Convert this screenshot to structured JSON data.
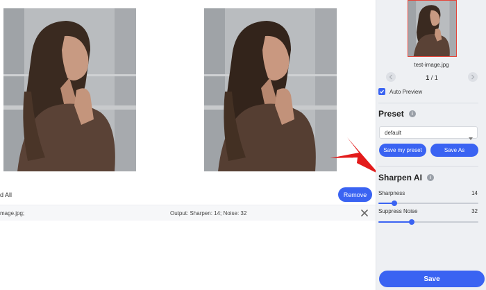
{
  "list": {
    "added_all": "d All",
    "remove_label": "Remove"
  },
  "file": {
    "name": "mage.jpg;",
    "output": "Output: Sharpen: 14; Noise: 32"
  },
  "sidebar": {
    "thumbnail_name": "test-image.jpg",
    "page_current": "1",
    "page_separator": " / ",
    "page_total": "1",
    "auto_preview_label": "Auto Preview",
    "auto_preview_checked": true,
    "preset": {
      "title": "Preset",
      "selected": "default",
      "save_my_preset_label": "Save my preset",
      "save_as_label": "Save As"
    },
    "sharpen": {
      "title": "Sharpen AI",
      "sharpness_label": "Sharpness",
      "sharpness_value": "14",
      "sharpness_fraction": 0.16,
      "noise_label": "Suppress Noise",
      "noise_value": "32",
      "noise_fraction": 0.33
    },
    "save_label": "Save"
  },
  "colors": {
    "accent": "#3a63f2",
    "arrow": "#e31b1b",
    "thumb_border": "#e4463b"
  },
  "icons": {
    "info": "info-icon",
    "prev": "chevron-left-icon",
    "next": "chevron-right-icon",
    "close": "close-icon",
    "caret": "chevron-down-icon",
    "check": "check-icon"
  }
}
